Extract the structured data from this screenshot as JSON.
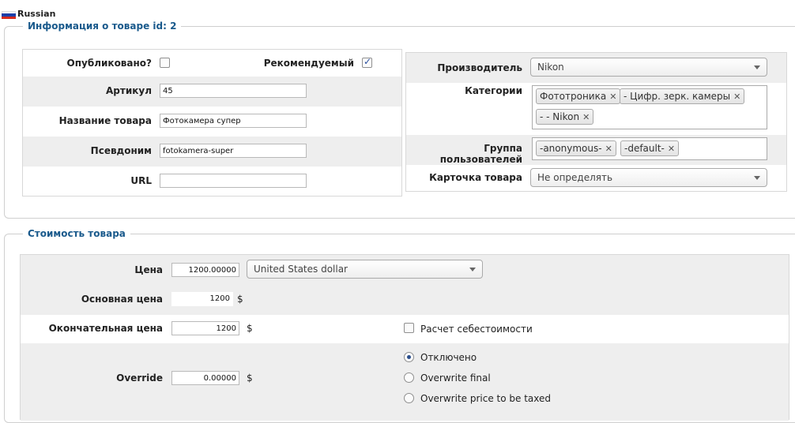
{
  "language": {
    "label": "Russian",
    "flag_icon": "flag-russia-icon"
  },
  "product_info": {
    "legend": "Информация о товаре id: 2",
    "published_label": "Опубликовано?",
    "published_checked": false,
    "featured_label": "Рекомендуемый",
    "featured_checked": true,
    "sku_label": "Артикул",
    "sku_value": "45",
    "name_label": "Название товара",
    "name_value": "Фотокамера супер",
    "alias_label": "Псевдоним",
    "alias_value": "fotokamera-super",
    "url_label": "URL",
    "url_value": "",
    "manufacturer_label": "Производитель",
    "manufacturer_value": "Nikon",
    "categories_label": "Категории",
    "categories": [
      "Фототроника",
      "- Цифр. зерк. камеры",
      "- - Nikon"
    ],
    "user_group_label": "Группа пользователей",
    "user_groups": [
      "-anonymous-",
      "-default-"
    ],
    "product_card_label": "Карточка товара",
    "product_card_value": "Не определять"
  },
  "pricing": {
    "legend": "Стоимость товара",
    "price_label": "Цена",
    "price_value": "1200.00000",
    "currency_value": "United States dollar",
    "base_price_label": "Основная цена",
    "base_price_value": "1200",
    "base_price_currency": "$",
    "final_price_label": "Окончательная цена",
    "final_price_value": "1200",
    "final_price_currency": "$",
    "cost_calc_label": "Расчет себестоимости",
    "cost_calc_checked": false,
    "override_label": "Override",
    "override_value": "0.00000",
    "override_currency": "$",
    "override_options": [
      "Отключено",
      "Overwrite final",
      "Overwrite price to be taxed"
    ],
    "override_selected": 0
  },
  "colors": {
    "legend": "#1a5a8c",
    "row_shade": "#eeeeee",
    "border": "#cfcfcf"
  }
}
